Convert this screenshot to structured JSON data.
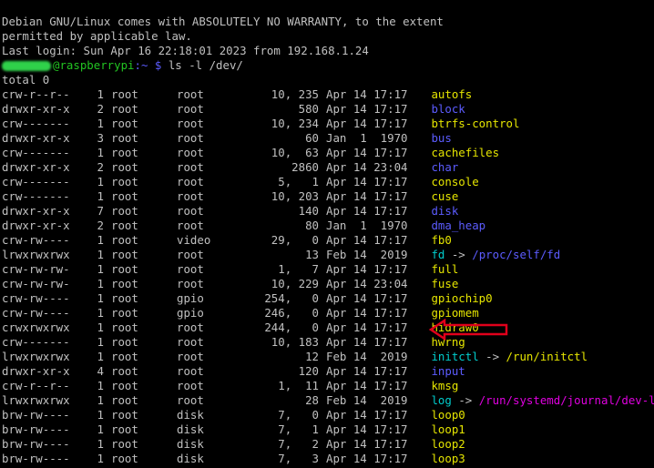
{
  "motd": [
    "Debian GNU/Linux comes with ABSOLUTELY NO WARRANTY, to the extent",
    "permitted by applicable law.",
    "Last login: Sun Apr 16 22:18:01 2023 from 192.168.1.24"
  ],
  "prompt": {
    "host": "@raspberrypi",
    "path": ":~ $",
    "command": " ls -l /dev/"
  },
  "total": "total 0",
  "colors": {
    "device": "#e5e500",
    "directory": "#5c5cff",
    "symlink": "#00cdcd",
    "prompt": "#22c422",
    "annotation_arrow": "#e0001b"
  },
  "entries": [
    {
      "perm": "crw-r--r--",
      "links": "1",
      "owner": "root",
      "group": "root",
      "size": "10, 235",
      "date": "Apr 14 17:17",
      "name": "autofs",
      "type": "device"
    },
    {
      "perm": "drwxr-xr-x",
      "links": "2",
      "owner": "root",
      "group": "root",
      "size": "580",
      "date": "Apr 14 17:17",
      "name": "block",
      "type": "directory"
    },
    {
      "perm": "crw-------",
      "links": "1",
      "owner": "root",
      "group": "root",
      "size": "10, 234",
      "date": "Apr 14 17:17",
      "name": "btrfs-control",
      "type": "device"
    },
    {
      "perm": "drwxr-xr-x",
      "links": "3",
      "owner": "root",
      "group": "root",
      "size": "60",
      "date": "Jan  1  1970",
      "name": "bus",
      "type": "directory"
    },
    {
      "perm": "crw-------",
      "links": "1",
      "owner": "root",
      "group": "root",
      "size": "10,  63",
      "date": "Apr 14 17:17",
      "name": "cachefiles",
      "type": "device"
    },
    {
      "perm": "drwxr-xr-x",
      "links": "2",
      "owner": "root",
      "group": "root",
      "size": "2860",
      "date": "Apr 14 23:04",
      "name": "char",
      "type": "directory"
    },
    {
      "perm": "crw-------",
      "links": "1",
      "owner": "root",
      "group": "root",
      "size": "5,   1",
      "date": "Apr 14 17:17",
      "name": "console",
      "type": "device"
    },
    {
      "perm": "crw-------",
      "links": "1",
      "owner": "root",
      "group": "root",
      "size": "10, 203",
      "date": "Apr 14 17:17",
      "name": "cuse",
      "type": "device"
    },
    {
      "perm": "drwxr-xr-x",
      "links": "7",
      "owner": "root",
      "group": "root",
      "size": "140",
      "date": "Apr 14 17:17",
      "name": "disk",
      "type": "directory"
    },
    {
      "perm": "drwxr-xr-x",
      "links": "2",
      "owner": "root",
      "group": "root",
      "size": "80",
      "date": "Jan  1  1970",
      "name": "dma_heap",
      "type": "directory"
    },
    {
      "perm": "crw-rw----",
      "links": "1",
      "owner": "root",
      "group": "video",
      "size": "29,   0",
      "date": "Apr 14 17:17",
      "name": "fb0",
      "type": "device"
    },
    {
      "perm": "lrwxrwxrwx",
      "links": "1",
      "owner": "root",
      "group": "root",
      "size": "13",
      "date": "Feb 14  2019",
      "name": "fd",
      "target": "/proc/self/fd",
      "type": "symlink",
      "target_type": "directory"
    },
    {
      "perm": "crw-rw-rw-",
      "links": "1",
      "owner": "root",
      "group": "root",
      "size": "1,   7",
      "date": "Apr 14 17:17",
      "name": "full",
      "type": "device"
    },
    {
      "perm": "crw-rw-rw-",
      "links": "1",
      "owner": "root",
      "group": "root",
      "size": "10, 229",
      "date": "Apr 14 23:04",
      "name": "fuse",
      "type": "device"
    },
    {
      "perm": "crw-rw----",
      "links": "1",
      "owner": "root",
      "group": "gpio",
      "size": "254,   0",
      "date": "Apr 14 17:17",
      "name": "gpiochip0",
      "type": "device"
    },
    {
      "perm": "crw-rw----",
      "links": "1",
      "owner": "root",
      "group": "gpio",
      "size": "246,   0",
      "date": "Apr 14 17:17",
      "name": "gpiomem",
      "type": "device"
    },
    {
      "perm": "crwxrwxrwx",
      "links": "1",
      "owner": "root",
      "group": "root",
      "size": "244,   0",
      "date": "Apr 14 17:17",
      "name": "hidraw0",
      "type": "device",
      "highlighted": true
    },
    {
      "perm": "crw-------",
      "links": "1",
      "owner": "root",
      "group": "root",
      "size": "10, 183",
      "date": "Apr 14 17:17",
      "name": "hwrng",
      "type": "device"
    },
    {
      "perm": "lrwxrwxrwx",
      "links": "1",
      "owner": "root",
      "group": "root",
      "size": "12",
      "date": "Feb 14  2019",
      "name": "initctl",
      "target": "/run/initctl",
      "type": "symlink",
      "target_type": "pipe"
    },
    {
      "perm": "drwxr-xr-x",
      "links": "4",
      "owner": "root",
      "group": "root",
      "size": "120",
      "date": "Apr 14 17:17",
      "name": "input",
      "type": "directory"
    },
    {
      "perm": "crw-r--r--",
      "links": "1",
      "owner": "root",
      "group": "root",
      "size": "1,  11",
      "date": "Apr 14 17:17",
      "name": "kmsg",
      "type": "device"
    },
    {
      "perm": "lrwxrwxrwx",
      "links": "1",
      "owner": "root",
      "group": "root",
      "size": "28",
      "date": "Feb 14  2019",
      "name": "log",
      "target": "/run/systemd/journal/dev-log",
      "type": "symlink",
      "target_type": "socket"
    },
    {
      "perm": "brw-rw----",
      "links": "1",
      "owner": "root",
      "group": "disk",
      "size": "7,   0",
      "date": "Apr 14 17:17",
      "name": "loop0",
      "type": "device"
    },
    {
      "perm": "brw-rw----",
      "links": "1",
      "owner": "root",
      "group": "disk",
      "size": "7,   1",
      "date": "Apr 14 17:17",
      "name": "loop1",
      "type": "device"
    },
    {
      "perm": "brw-rw----",
      "links": "1",
      "owner": "root",
      "group": "disk",
      "size": "7,   2",
      "date": "Apr 14 17:17",
      "name": "loop2",
      "type": "device"
    },
    {
      "perm": "brw-rw----",
      "links": "1",
      "owner": "root",
      "group": "disk",
      "size": "7,   3",
      "date": "Apr 14 17:17",
      "name": "loop3",
      "type": "device"
    }
  ]
}
